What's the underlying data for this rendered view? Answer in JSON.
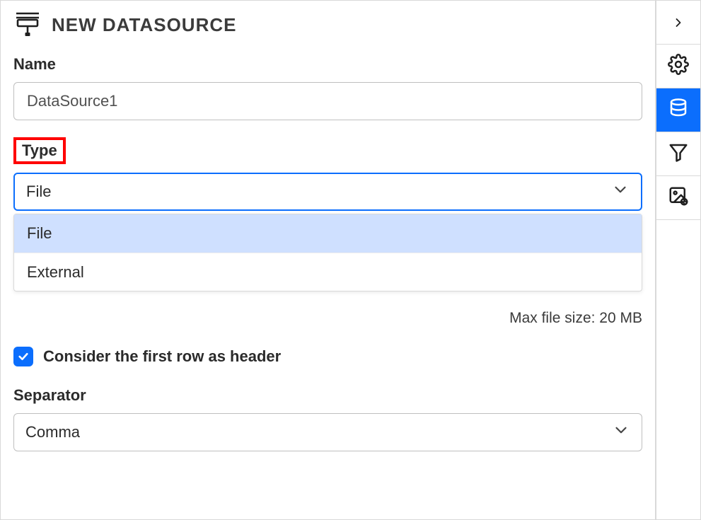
{
  "header": {
    "title": "NEW DATASOURCE"
  },
  "name": {
    "label": "Name",
    "value": "DataSource1"
  },
  "type": {
    "label": "Type",
    "selected": "File",
    "options": [
      "File",
      "External"
    ]
  },
  "maxFileHint": "Max file size: 20 MB",
  "headerCheckbox": {
    "checked": true,
    "label": "Consider the first row as header"
  },
  "separator": {
    "label": "Separator",
    "selected": "Comma"
  },
  "sidebar": {
    "items": [
      {
        "name": "collapse",
        "active": false
      },
      {
        "name": "settings",
        "active": false
      },
      {
        "name": "datasource",
        "active": true
      },
      {
        "name": "filter",
        "active": false
      },
      {
        "name": "image-settings",
        "active": false
      }
    ]
  }
}
